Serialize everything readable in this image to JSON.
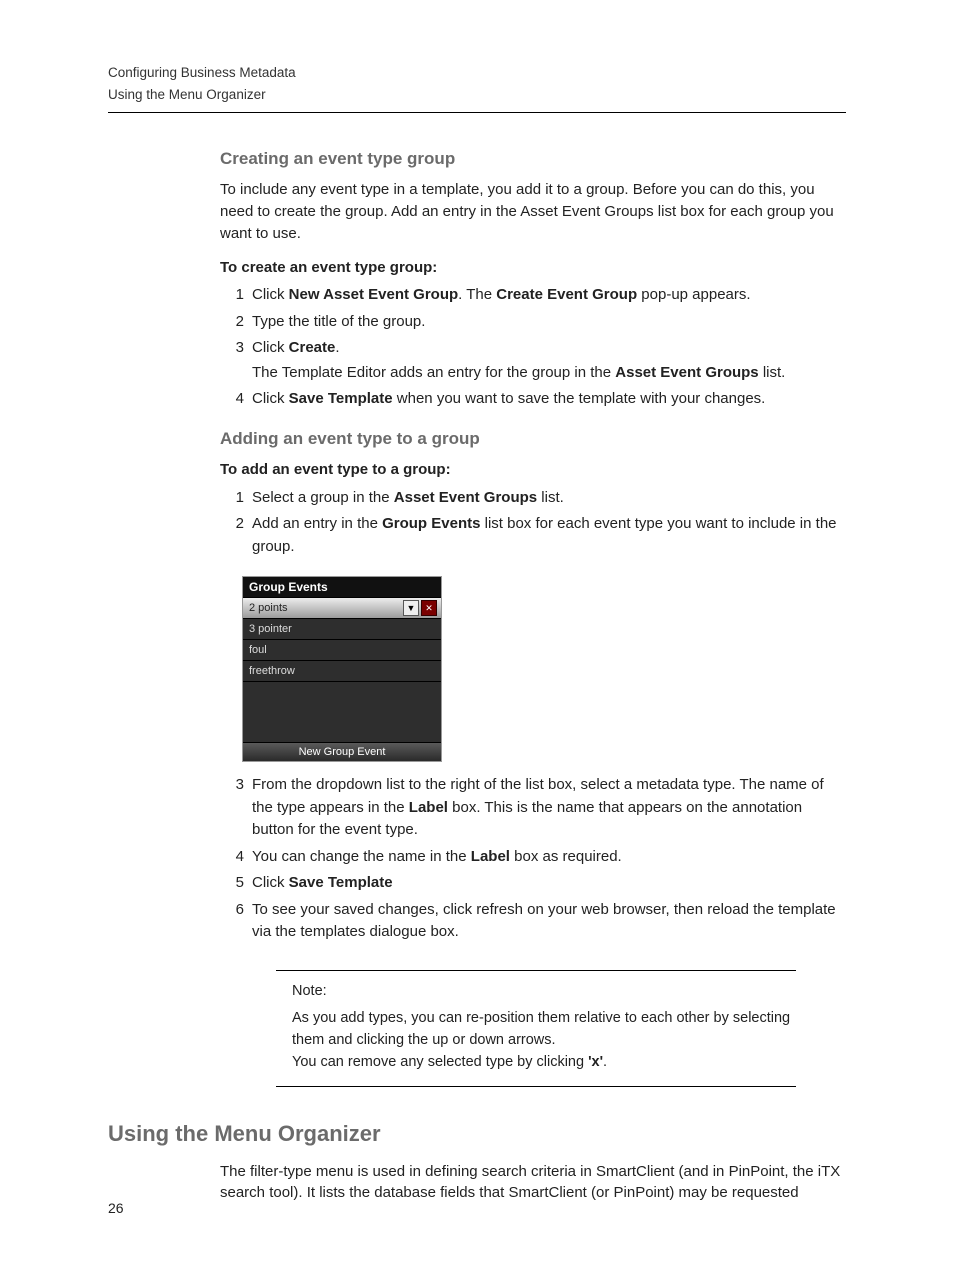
{
  "header": {
    "line1": "Configuring Business Metadata",
    "line2": "Using the Menu Organizer"
  },
  "s1": {
    "title": "Creating an event type group",
    "intro": "To include any event type in a template, you add it to a group. Before you can do this, you need to create the group. Add an entry in the Asset Event Groups list box for each group you want to use.",
    "lead": "To create an event type group:",
    "step1_a": "Click ",
    "step1_b": "New Asset Event Group",
    "step1_c": ". The ",
    "step1_d": "Create Event Group",
    "step1_e": " pop-up appears.",
    "step2": "Type the title of the group.",
    "step3_a": "Click ",
    "step3_b": "Create",
    "step3_c": ".",
    "step3_sub_a": "The Template Editor adds an entry for the group in the ",
    "step3_sub_b": "Asset Event Groups",
    "step3_sub_c": " list.",
    "step4_a": "Click ",
    "step4_b": "Save Template",
    "step4_c": " when you want to save the template with your changes."
  },
  "s2": {
    "title": "Adding an event type to a group",
    "lead": "To add an event type to a group:",
    "step1_a": "Select a group in the ",
    "step1_b": "Asset Event Groups",
    "step1_c": " list.",
    "step2_a": "Add an entry in the ",
    "step2_b": "Group Events",
    "step2_c": " list box for each event type you want to include in the group.",
    "panel": {
      "title": "Group Events",
      "rows": [
        "2 points",
        "3 pointer",
        "foul",
        "freethrow"
      ],
      "button": "New Group Event"
    },
    "step3_a": "From the dropdown list to the right of the list box, select a metadata type. The name of the type appears in the ",
    "step3_b": "Label",
    "step3_c": " box. This is the name that appears on the annotation button for the event type.",
    "step4_a": "You can change the name in the ",
    "step4_b": "Label",
    "step4_c": " box as required.",
    "step5_a": "Click ",
    "step5_b": "Save Template",
    "step6": "To see your saved changes, click refresh on your web browser, then reload the template via the templates dialogue box."
  },
  "note": {
    "label": "Note:",
    "line1": "As you add types, you can re-position them relative to each other by selecting them and clicking the up or down arrows.",
    "line2_a": "You can remove any selected type by clicking ",
    "line2_b": "'x'",
    "line2_c": "."
  },
  "s3": {
    "title": "Using the Menu Organizer",
    "para": "The filter-type menu is used in defining search criteria in SmartClient (and in PinPoint, the iTX search tool). It lists the database fields that SmartClient (or PinPoint) may be requested"
  },
  "pageNumber": "26"
}
